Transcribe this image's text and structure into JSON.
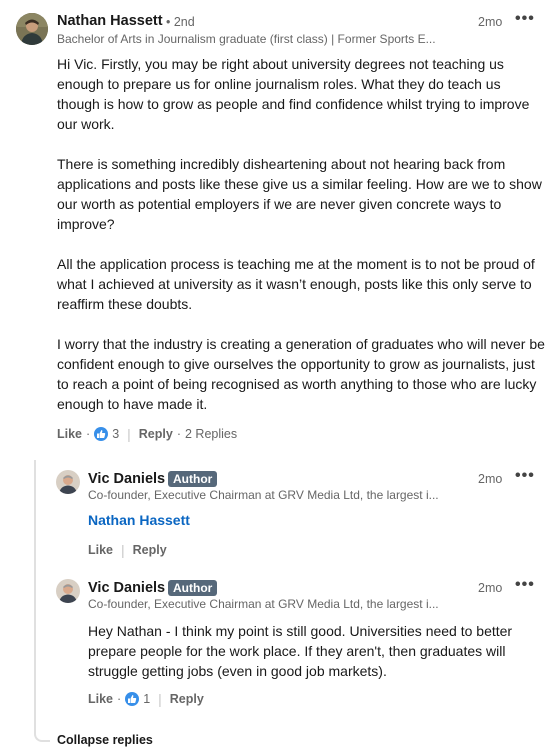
{
  "main_comment": {
    "author": "Nathan Hassett",
    "degree": "• 2nd",
    "headline": "Bachelor of Arts in Journalism graduate (first class) | Former Sports E...",
    "time": "2mo",
    "paragraphs": [
      "Hi Vic. Firstly, you may be right about university degrees not teaching us enough to prepare us for online journalism roles. What they do teach us though is how to grow as people and find confidence whilst trying to improve our work.",
      "There is something incredibly disheartening about not hearing back from applications and posts like these give us a similar feeling. How are we to show our worth as potential employers if we are never given concrete ways to improve?",
      "All the application process is teaching me at the moment is to not be proud of what I achieved at university as it wasn’t enough, posts like this only serve to reaffirm these doubts.",
      "I worry that the industry is creating a generation of graduates who will never be confident enough to give ourselves the opportunity to grow as journalists, just to reach a point of being recognised as worth anything to those who are lucky enough to have made it."
    ],
    "like_label": "Like",
    "like_count": "3",
    "reply_label": "Reply",
    "replies_count": "2 Replies"
  },
  "replies": [
    {
      "author": "Vic Daniels",
      "badge": "Author",
      "headline": "Co-founder, Executive Chairman at GRV Media Ltd, the largest i...",
      "time": "2mo",
      "mention": "Nathan Hassett",
      "like_label": "Like",
      "reply_label": "Reply"
    },
    {
      "author": "Vic Daniels",
      "badge": "Author",
      "headline": "Co-founder, Executive Chairman at GRV Media Ltd, the largest i...",
      "time": "2mo",
      "text": "Hey Nathan - I think my point is still good. Universities need to better prepare people for the work place. If they aren't, then graduates will struggle getting jobs (even in good job markets).",
      "like_label": "Like",
      "like_count": "1",
      "reply_label": "Reply"
    }
  ],
  "collapse_label": "Collapse replies",
  "colors": {
    "accent": "#0a66c2",
    "like_blue": "#378fe9",
    "badge_bg": "#56687a"
  }
}
